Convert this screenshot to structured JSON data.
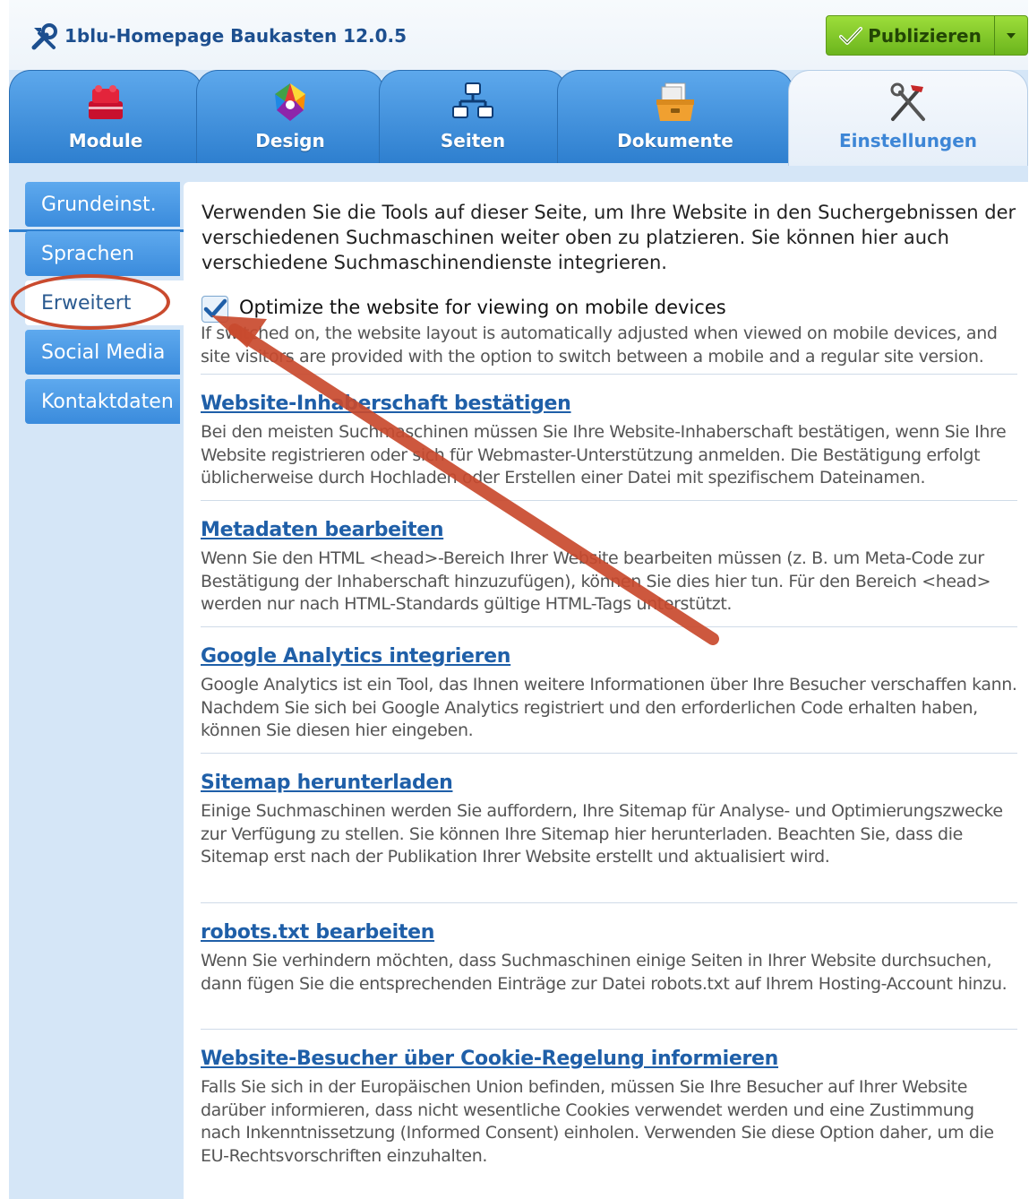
{
  "header": {
    "title": "1blu-Homepage Baukasten 12.0.5",
    "logo_icon": "tools-icon",
    "publish_label": "Publizieren",
    "publish_icon": "checkmark-icon",
    "publish_dropdown_icon": "caret-down-icon"
  },
  "tabs": [
    {
      "label": "Module",
      "icon": "bricks-icon",
      "active": false
    },
    {
      "label": "Design",
      "icon": "color-palette-icon",
      "active": false
    },
    {
      "label": "Seiten",
      "icon": "sitemap-icon",
      "active": false
    },
    {
      "label": "Dokumente",
      "icon": "documents-box-icon",
      "active": false
    },
    {
      "label": "Einstellungen",
      "icon": "hammer-wrench-icon",
      "active": true
    }
  ],
  "sidebar": {
    "items": [
      {
        "label": "Grundeinst.",
        "active": false
      },
      {
        "label": "Sprachen",
        "active": false
      },
      {
        "label": "Erweitert",
        "active": true
      },
      {
        "label": "Social Media",
        "active": false
      },
      {
        "label": "Kontaktdaten",
        "active": false
      }
    ]
  },
  "content": {
    "intro": "Verwenden Sie die Tools auf dieser Seite, um Ihre Website in den Suchergebnissen der verschiedenen Suchmaschinen weiter oben zu platzieren. Sie können hier auch verschiedene Suchmaschinendienste integrieren.",
    "mobile_option": {
      "label": "Optimize the website for viewing on mobile devices",
      "checked": true,
      "description": "If switched on, the website layout is automatically adjusted when viewed on mobile devices, and site visitors are provided with the option to switch between a mobile and a regular site version."
    },
    "sections": [
      {
        "title": "Website-Inhaberschaft bestätigen",
        "description": "Bei den meisten Suchmaschinen müssen Sie Ihre Website-Inhaberschaft bestätigen, wenn Sie Ihre Website registrieren oder sich für Webmaster-Unterstützung anmelden. Die Bestätigung erfolgt üblicherweise durch Hochladen oder Erstellen einer Datei mit spezifischem Dateinamen."
      },
      {
        "title": "Metadaten bearbeiten",
        "description": "Wenn Sie den HTML <head>-Bereich Ihrer Website bearbeiten müssen (z. B. um Meta-Code zur Bestätigung der Inhaberschaft hinzuzufügen), können Sie dies hier tun. Für den Bereich <head> werden nur nach HTML-Standards gültige HTML-Tags unterstützt."
      },
      {
        "title": "Google Analytics integrieren",
        "description": "Google Analytics ist ein Tool, das Ihnen weitere Informationen über Ihre Besucher verschaffen kann. Nachdem Sie sich bei Google Analytics registriert und den erforderlichen Code erhalten haben, können Sie diesen hier eingeben."
      },
      {
        "title": "Sitemap herunterladen",
        "description": "Einige Suchmaschinen werden Sie auffordern, Ihre Sitemap für Analyse- und Optimierungszwecke zur Verfügung zu stellen. Sie können Ihre Sitemap hier herunterladen. Beachten Sie, dass die Sitemap erst nach der Publikation Ihrer Website erstellt und aktualisiert wird."
      },
      {
        "title": "robots.txt bearbeiten",
        "description": "Wenn Sie verhindern möchten, dass Suchmaschinen einige Seiten in Ihrer Website durchsuchen, dann fügen Sie die entsprechenden Einträge zur Datei robots.txt auf Ihrem Hosting-Account hinzu."
      },
      {
        "title": "Website-Besucher über Cookie-Regelung informieren",
        "description": "Falls Sie sich in der Europäischen Union befinden, müssen Sie Ihre Besucher auf Ihrer Website darüber informieren, dass nicht wesentliche Cookies verwendet werden und eine Zustimmung nach Inkenntnissetzung (Informed Consent) einholen. Verwenden Sie diese Option daher, um die EU-Rechtsvorschriften einzuhalten."
      }
    ]
  },
  "colors": {
    "tab_blue": "#3a8bdc",
    "publish_green": "#7cc52a",
    "link_blue": "#1f5fa8",
    "annotation_red": "#c94a2e",
    "background": "#d5e6f7"
  },
  "annotations": {
    "highlight_ring": "red ellipse around sidebar item Erweitert",
    "arrow": "red arrow pointing to the mobile optimization checkbox"
  }
}
